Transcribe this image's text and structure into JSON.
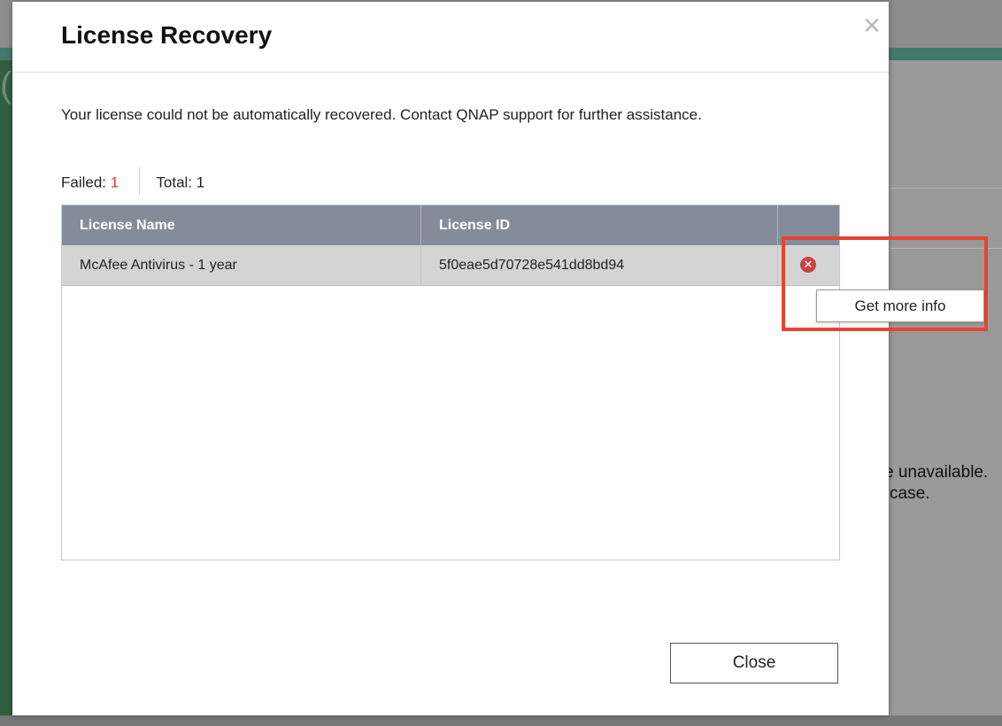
{
  "background": {
    "partial_text_line1": "e unavailable.",
    "partial_text_line2": "case."
  },
  "dialog": {
    "title": "License Recovery",
    "close_icon": "close-icon",
    "message": "Your license could not be automatically recovered. Contact QNAP support for further assistance.",
    "stats": {
      "failed_label": "Failed:",
      "failed_count": "1",
      "total_label": "Total:",
      "total_count": "1"
    },
    "table": {
      "columns": [
        "License Name",
        "License ID",
        ""
      ],
      "rows": [
        {
          "license_name": "McAfee Antivirus - 1 year",
          "license_id": "5f0eae5d70728e541dd8bd94",
          "status_icon": "error-circle-icon"
        }
      ]
    },
    "popup": {
      "more_info_label": "Get more info"
    },
    "close_button_label": "Close"
  },
  "colors": {
    "failed_count": "#d9382d",
    "table_header": "#858c99",
    "selected_row": "#d4d4d4",
    "error_icon": "#c94444",
    "highlight_border": "#e8432f"
  }
}
